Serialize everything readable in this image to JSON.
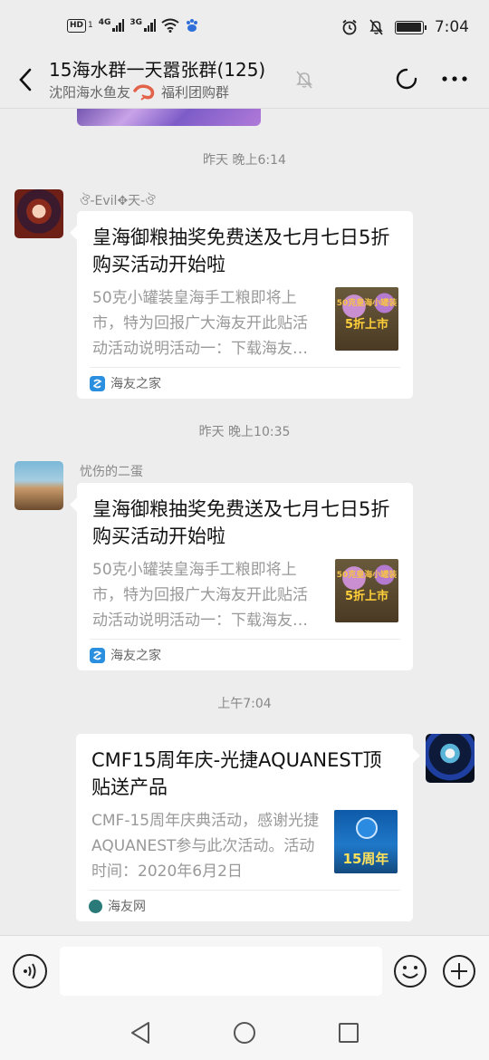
{
  "status_bar": {
    "hd": "HD",
    "hd_sub": "1",
    "net1": "4G",
    "net2": "3G",
    "time": "7:04"
  },
  "header": {
    "title": "15海水群一天嚣张群(125)",
    "subtitle_a": "沈阳海水鱼友",
    "subtitle_b": "福利团购群"
  },
  "messages": [
    {
      "timestamp": "昨天 晚上6:14",
      "sender": "ঔ-Evil✥天-ঔ",
      "title": "皇海御粮抽奖免费送及七月七日5折购买活动开始啦",
      "desc": "50克小罐装皇海手工粮即将上市，特为回报广大海友开此贴活动活动说明活动一：下载海友之家",
      "thumb_line1": "50克皇海小罐装",
      "thumb_line2": "5折上市",
      "source": "海友之家"
    },
    {
      "timestamp": "昨天 晚上10:35",
      "sender": "忧伤的二蛋",
      "title": "皇海御粮抽奖免费送及七月七日5折购买活动开始啦",
      "desc": "50克小罐装皇海手工粮即将上市，特为回报广大海友开此贴活动活动说明活动一：下载海友之家",
      "thumb_line1": "50克皇海小罐装",
      "thumb_line2": "5折上市",
      "source": "海友之家"
    },
    {
      "timestamp": "上午7:04",
      "title": "CMF15周年庆-光捷AQUANEST顶贴送产品",
      "desc": "CMF-15周年庆典活动，感谢光捷AQUANEST参与此次活动。活动时间：2020年6月2日",
      "thumb_text": "15周年",
      "source": "海友网"
    }
  ]
}
